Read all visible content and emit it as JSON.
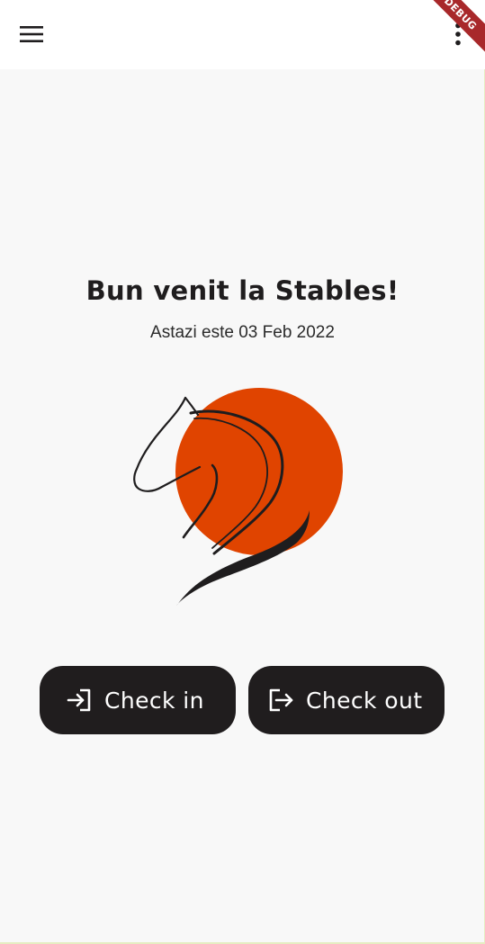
{
  "app_bar": {
    "menu_icon": "hamburger-menu-icon",
    "overflow_icon": "more-vert-icon",
    "debug_banner": "DEBUG"
  },
  "main": {
    "title": "Bun venit la Stables!",
    "date_line": "Astazi este 03 Feb 2022",
    "logo": "horse-head-logo",
    "accent_color": "#e04400"
  },
  "actions": {
    "check_in": {
      "label": "Check in",
      "icon": "login-icon"
    },
    "check_out": {
      "label": "Check out",
      "icon": "logout-icon"
    },
    "button_color": "#201d1e"
  }
}
